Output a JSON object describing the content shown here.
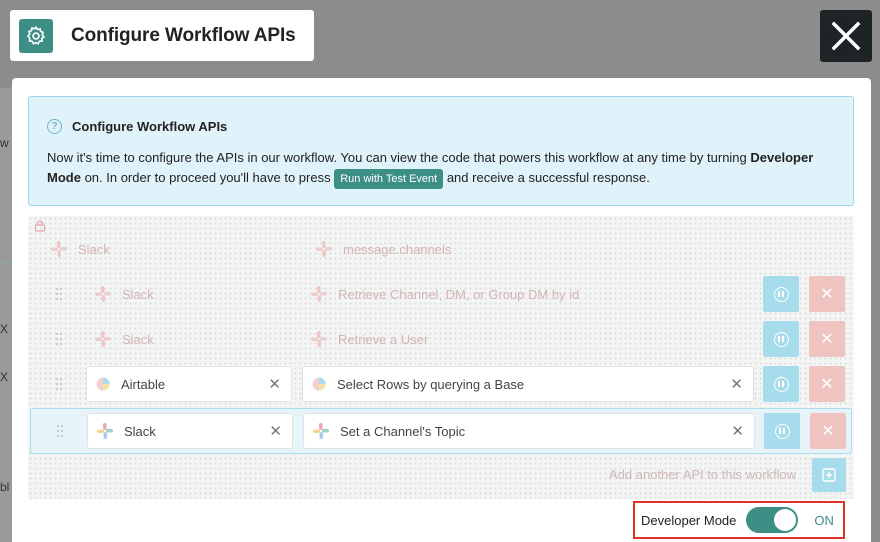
{
  "header": {
    "title": "Configure Workflow APIs"
  },
  "background": {
    "fragments": [
      "w",
      "X",
      "X",
      "bl"
    ]
  },
  "info": {
    "heading": "Configure Workflow APIs",
    "text_part1": "Now it's time to configure the APIs in our workflow. You can view the code that powers this workflow at any time by turning ",
    "developer_mode_bold": "Developer Mode",
    "text_part2": " on. In order to proceed you'll have to press ",
    "button_label": "Run with Test Event",
    "text_part3": " and receive a successful response."
  },
  "trigger": {
    "app": "Slack",
    "event": "message.channels"
  },
  "rows": [
    {
      "app": "Slack",
      "action": "Retrieve Channel, DM, or Group DM by id",
      "state": "locked"
    },
    {
      "app": "Slack",
      "action": "Retrieve a User",
      "state": "locked"
    },
    {
      "app": "Airtable",
      "action": "Select Rows by querying a Base",
      "state": "editable"
    },
    {
      "app": "Slack",
      "action": "Set a Channel's Topic",
      "state": "active"
    }
  ],
  "add_api": {
    "label": "Add another API to this workflow"
  },
  "developer_mode": {
    "label": "Developer Mode",
    "state_label": "ON",
    "enabled": true
  },
  "colors": {
    "accent": "#3d8f86",
    "info_bg": "#e1f3fa",
    "highlight_border": "#e0332a",
    "run_button_bg": "#a6dcec",
    "delete_button_bg": "#eec3c0"
  }
}
